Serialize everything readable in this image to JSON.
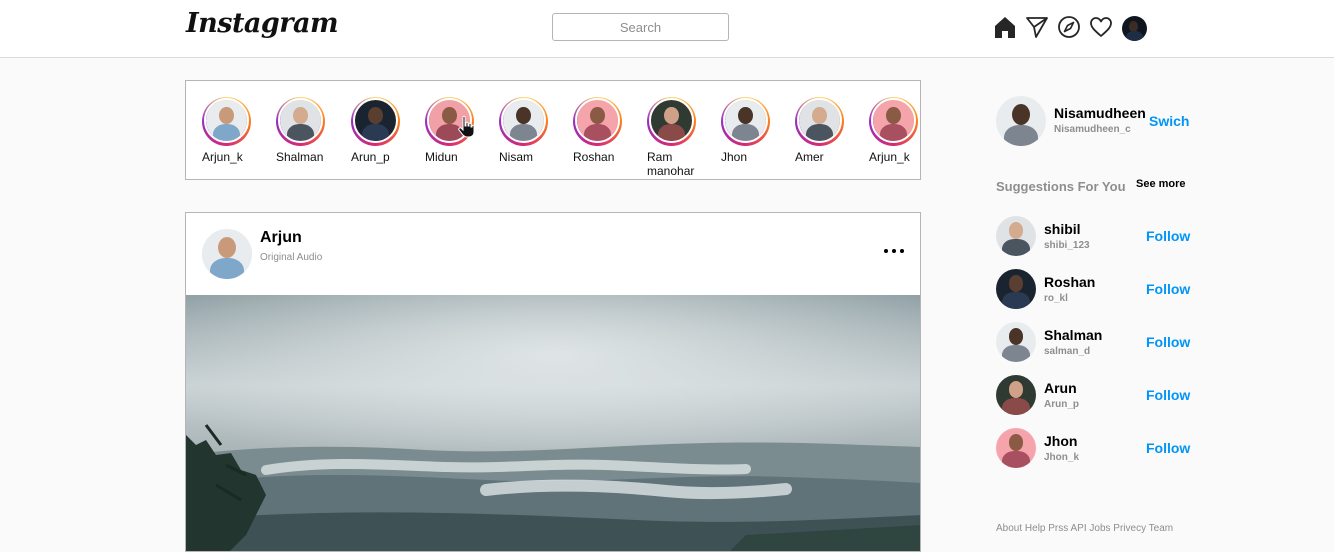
{
  "brand": {
    "logo_text": "Instagram"
  },
  "search": {
    "placeholder": "Search"
  },
  "nav": {
    "icons": [
      "home-icon",
      "send-icon",
      "explore-icon",
      "heart-icon",
      "profile-avatar"
    ]
  },
  "stories": [
    {
      "name": "Arjun_k"
    },
    {
      "name": "Shalman"
    },
    {
      "name": "Arun_p"
    },
    {
      "name": "Midun"
    },
    {
      "name": "Nisam"
    },
    {
      "name": "Roshan"
    },
    {
      "name": "Ram manohar"
    },
    {
      "name": "Jhon"
    },
    {
      "name": "Amer"
    },
    {
      "name": "Arjun_k"
    }
  ],
  "post": {
    "username": "Arjun",
    "subtitle": "Original Audio"
  },
  "sidebar": {
    "profile": {
      "name": "Nisamudheen",
      "handle": "Nisamudheen_c",
      "switch_label": "Swich"
    },
    "suggestions_title": "Suggestions For You",
    "see_more": "See more",
    "suggestions": [
      {
        "name": "shibil",
        "handle": "shibi_123",
        "action": "Follow"
      },
      {
        "name": "Roshan",
        "handle": "ro_kl",
        "action": "Follow"
      },
      {
        "name": "Shalman",
        "handle": "salman_d",
        "action": "Follow"
      },
      {
        "name": "Arun",
        "handle": "Arun_p",
        "action": "Follow"
      },
      {
        "name": "Jhon",
        "handle": "Jhon_k",
        "action": "Follow"
      }
    ],
    "footer": "About Help Prss API Jobs Privecy Team"
  },
  "colors": {
    "link_blue": "#0095f6",
    "muted_text": "#8e8e8e",
    "border": "#b5b5b5",
    "page_bg": "#fafafa"
  }
}
